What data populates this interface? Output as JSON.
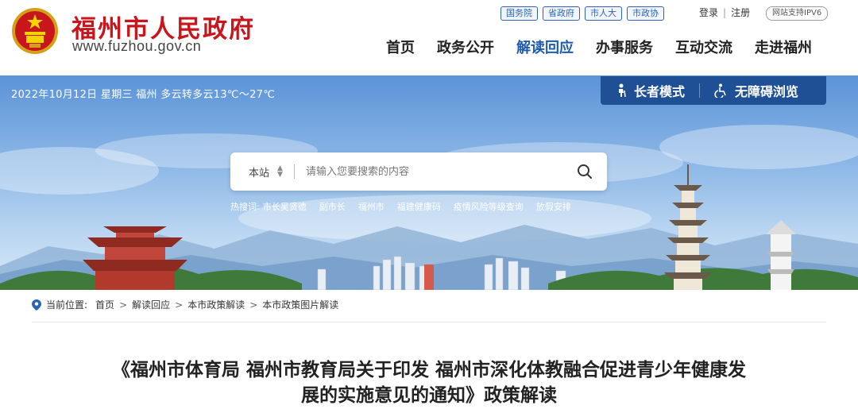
{
  "header": {
    "site_name": "福州市人民政府",
    "site_url": "www.fuzhou.gov.cn",
    "portals": [
      "国务院",
      "省政府",
      "市人大",
      "市政协"
    ],
    "login": "登录",
    "auth_separator": "|",
    "register": "注册",
    "ipv6": "网站支持IPV6",
    "nav": [
      {
        "label": "首页",
        "active": false
      },
      {
        "label": "政务公开",
        "active": false
      },
      {
        "label": "解读回应",
        "active": true
      },
      {
        "label": "办事服务",
        "active": false
      },
      {
        "label": "互动交流",
        "active": false
      },
      {
        "label": "走进福州",
        "active": false
      }
    ]
  },
  "banner": {
    "weather": "2022年10月12日 星期三 福州 多云转多云13℃～27℃",
    "elder_mode": "长者模式",
    "accessibility": "无障碍浏览"
  },
  "search": {
    "scope": "本站",
    "placeholder": "请输入您要搜索的内容"
  },
  "hot": {
    "label": "热搜词:",
    "terms": [
      "市长吴贤德",
      "副市长",
      "福州市",
      "福建健康码",
      "疫情风险等级查询",
      "放假安排"
    ]
  },
  "breadcrumb": {
    "label": "当前位置:",
    "items": [
      "首页",
      "解读回应",
      "本市政策解读",
      "本市政策图片解读"
    ],
    "separator": ">"
  },
  "article": {
    "title_line1": "《福州市体育局 福州市教育局关于印发 福州市深化体教融合促进青少年健康发",
    "title_line2": "展的实施意见的通知》政策解读"
  },
  "colors": {
    "brand_red": "#c8161d",
    "nav_active": "#1e5bb0",
    "access_bar": "#1f4f94"
  }
}
